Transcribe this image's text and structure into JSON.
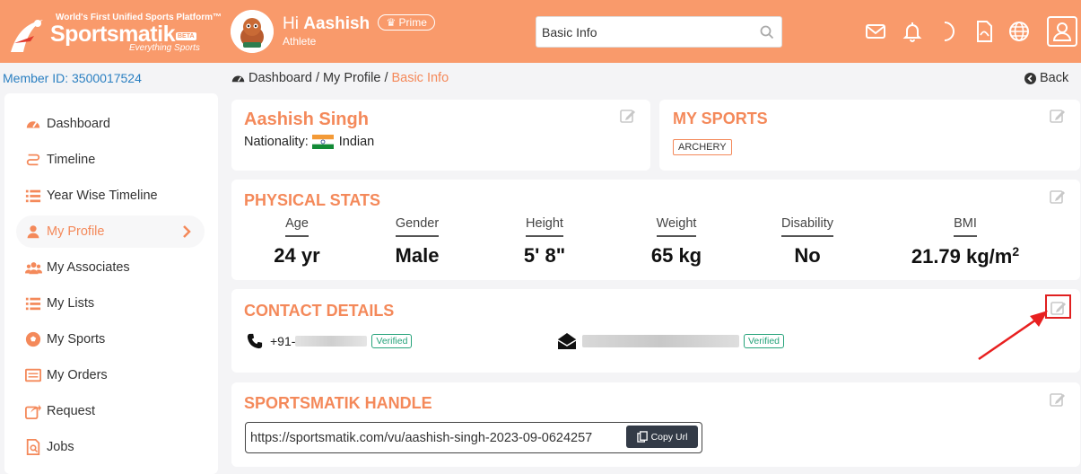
{
  "header": {
    "tagline": "World's First Unified Sports Platform™",
    "brand": "Sportsmatik",
    "beta": "BETA",
    "brand_sub": "Everything Sports",
    "greeting_prefix": "Hi",
    "user_name": "Aashish",
    "badge": "Prime",
    "role": "Athlete",
    "search_value": "Basic Info",
    "accent": "#f99a6b"
  },
  "sidebar": {
    "member_id": "Member ID: 3500017524",
    "items": [
      {
        "label": "Dashboard",
        "icon": "dashboard-icon"
      },
      {
        "label": "Timeline",
        "icon": "route-icon"
      },
      {
        "label": "Year Wise Timeline",
        "icon": "list-icon"
      },
      {
        "label": "My Profile",
        "icon": "user-icon",
        "active": true
      },
      {
        "label": "My Associates",
        "icon": "users-icon"
      },
      {
        "label": "My Lists",
        "icon": "list-icon"
      },
      {
        "label": "My Sports",
        "icon": "ball-icon"
      },
      {
        "label": "My Orders",
        "icon": "orders-icon"
      },
      {
        "label": "Request",
        "icon": "share-icon"
      },
      {
        "label": "Jobs",
        "icon": "jobs-icon"
      }
    ]
  },
  "breadcrumb": {
    "items": [
      "Dashboard",
      "My Profile"
    ],
    "current": "Basic Info",
    "back": "Back"
  },
  "profile": {
    "name": "Aashish Singh",
    "nationality_label": "Nationality:",
    "nationality": "Indian"
  },
  "sports": {
    "title": "MY SPORTS",
    "tags": [
      "ARCHERY"
    ]
  },
  "physical": {
    "title": "PHYSICAL STATS",
    "stats": [
      {
        "label": "Age",
        "value": "24 yr"
      },
      {
        "label": "Gender",
        "value": "Male"
      },
      {
        "label": "Height",
        "value": "5' 8\""
      },
      {
        "label": "Weight",
        "value": "65 kg"
      },
      {
        "label": "Disability",
        "value": "No"
      },
      {
        "label": "BMI",
        "value": "21.79 kg/m",
        "sup": "2"
      }
    ]
  },
  "contact": {
    "title": "CONTACT DETAILS",
    "phone_prefix": "+91-",
    "verified": "Verified"
  },
  "handle": {
    "title": "SPORTSMATIK HANDLE",
    "url": "https://sportsmatik.com/vu/aashish-singh-2023-09-0624257",
    "copy_label": "Copy Url"
  }
}
